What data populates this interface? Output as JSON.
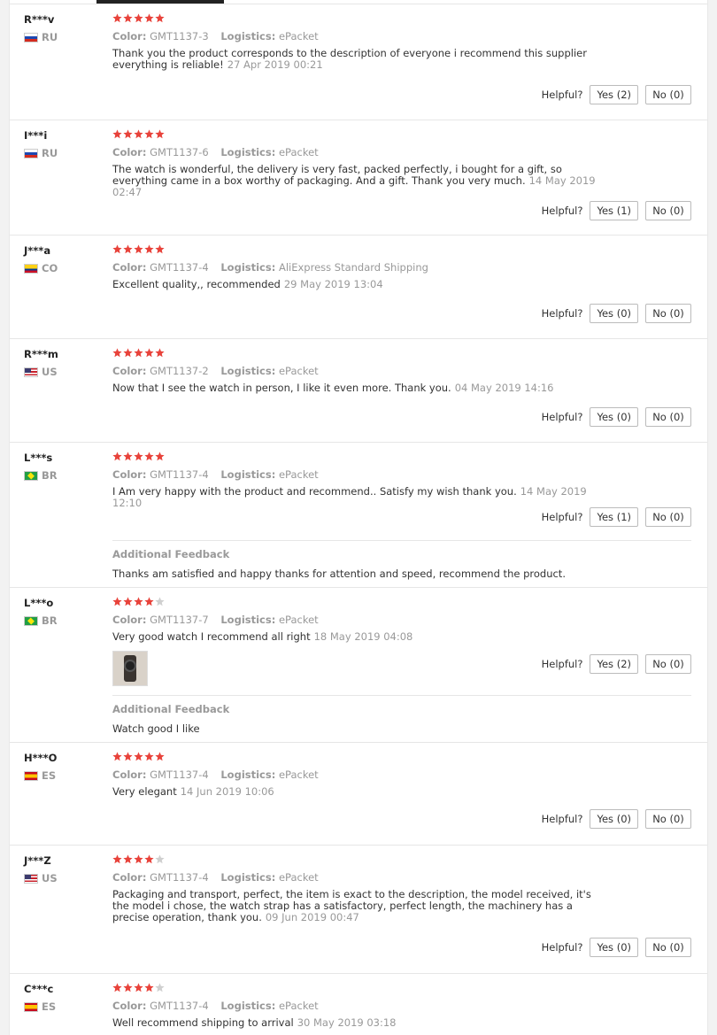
{
  "colors": {
    "star_filled": "#e8423a",
    "star_empty": "#cfcfcf",
    "muted": "#999999",
    "text": "#333333"
  },
  "labels": {
    "color_label": "Color:",
    "logistics_label": "Logistics:",
    "helpful_label": "Helpful?",
    "additional_feedback_title": "Additional Feedback"
  },
  "reviews": [
    {
      "user": "R***v",
      "country": "RU",
      "flag_icon": "russia-flag-icon",
      "rating": 5,
      "color": "GMT1137-3",
      "logistics": "ePacket",
      "text": "Thank you the product corresponds to the description of everyone i recommend this supplier everything is reliable!",
      "date": "27 Apr 2019 00:21",
      "yes": "Yes (2)",
      "no": "No (0)"
    },
    {
      "user": "I***i",
      "country": "RU",
      "flag_icon": "russia-flag-icon",
      "rating": 5,
      "color": "GMT1137-6",
      "logistics": "ePacket",
      "text": "The watch is wonderful, the delivery is very fast, packed perfectly, i bought for a gift, so everything came in a box worthy of packaging. And a gift. Thank you very much.",
      "date": "14 May 2019 02:47",
      "yes": "Yes (1)",
      "no": "No (0)"
    },
    {
      "user": "J***a",
      "country": "CO",
      "flag_icon": "colombia-flag-icon",
      "rating": 5,
      "color": "GMT1137-4",
      "logistics": "AliExpress Standard Shipping",
      "text": "Excellent quality,, recommended",
      "date": "29 May 2019 13:04",
      "yes": "Yes (0)",
      "no": "No (0)"
    },
    {
      "user": "R***m",
      "country": "US",
      "flag_icon": "usa-flag-icon",
      "rating": 5,
      "color": "GMT1137-2",
      "logistics": "ePacket",
      "text": "Now that I see the watch in person, I like it even more. Thank you.",
      "date": "04 May 2019 14:16",
      "yes": "Yes (0)",
      "no": "No (0)"
    },
    {
      "user": "L***s",
      "country": "BR",
      "flag_icon": "brazil-flag-icon",
      "rating": 5,
      "color": "GMT1137-4",
      "logistics": "ePacket",
      "text": "I Am very happy with the product and recommend.. Satisfy my wish thank you.",
      "date": "14 May 2019 12:10",
      "yes": "Yes (1)",
      "no": "No (0)",
      "additional_feedback": "Thanks am satisfied and happy thanks for attention and speed, recommend the product."
    },
    {
      "user": "L***o",
      "country": "BR",
      "flag_icon": "brazil-flag-icon",
      "rating": 4,
      "color": "GMT1137-7",
      "logistics": "ePacket",
      "text": "Very good watch I recommend all right",
      "date": "18 May 2019 04:08",
      "yes": "Yes (2)",
      "no": "No (0)",
      "has_photo": true,
      "additional_feedback": "Watch good I like"
    },
    {
      "user": "H***O",
      "country": "ES",
      "flag_icon": "spain-flag-icon",
      "rating": 5,
      "color": "GMT1137-4",
      "logistics": "ePacket",
      "text": "Very elegant",
      "date": "14 Jun 2019 10:06",
      "yes": "Yes (0)",
      "no": "No (0)"
    },
    {
      "user": "J***Z",
      "country": "US",
      "flag_icon": "usa-flag-icon",
      "rating": 4,
      "color": "GMT1137-4",
      "logistics": "ePacket",
      "text": "Packaging and transport, perfect, the item is exact to the description, the model received, it's the model i chose, the watch strap has a satisfactory, perfect length, the machinery has a precise operation, thank you.",
      "date": "09 Jun 2019 00:47",
      "yes": "Yes (0)",
      "no": "No (0)"
    },
    {
      "user": "C***c",
      "country": "ES",
      "flag_icon": "spain-flag-icon",
      "rating": 4,
      "color": "GMT1137-4",
      "logistics": "ePacket",
      "text": "Well recommend shipping to arrival",
      "date": "30 May 2019 03:18",
      "yes": "",
      "no": ""
    }
  ]
}
